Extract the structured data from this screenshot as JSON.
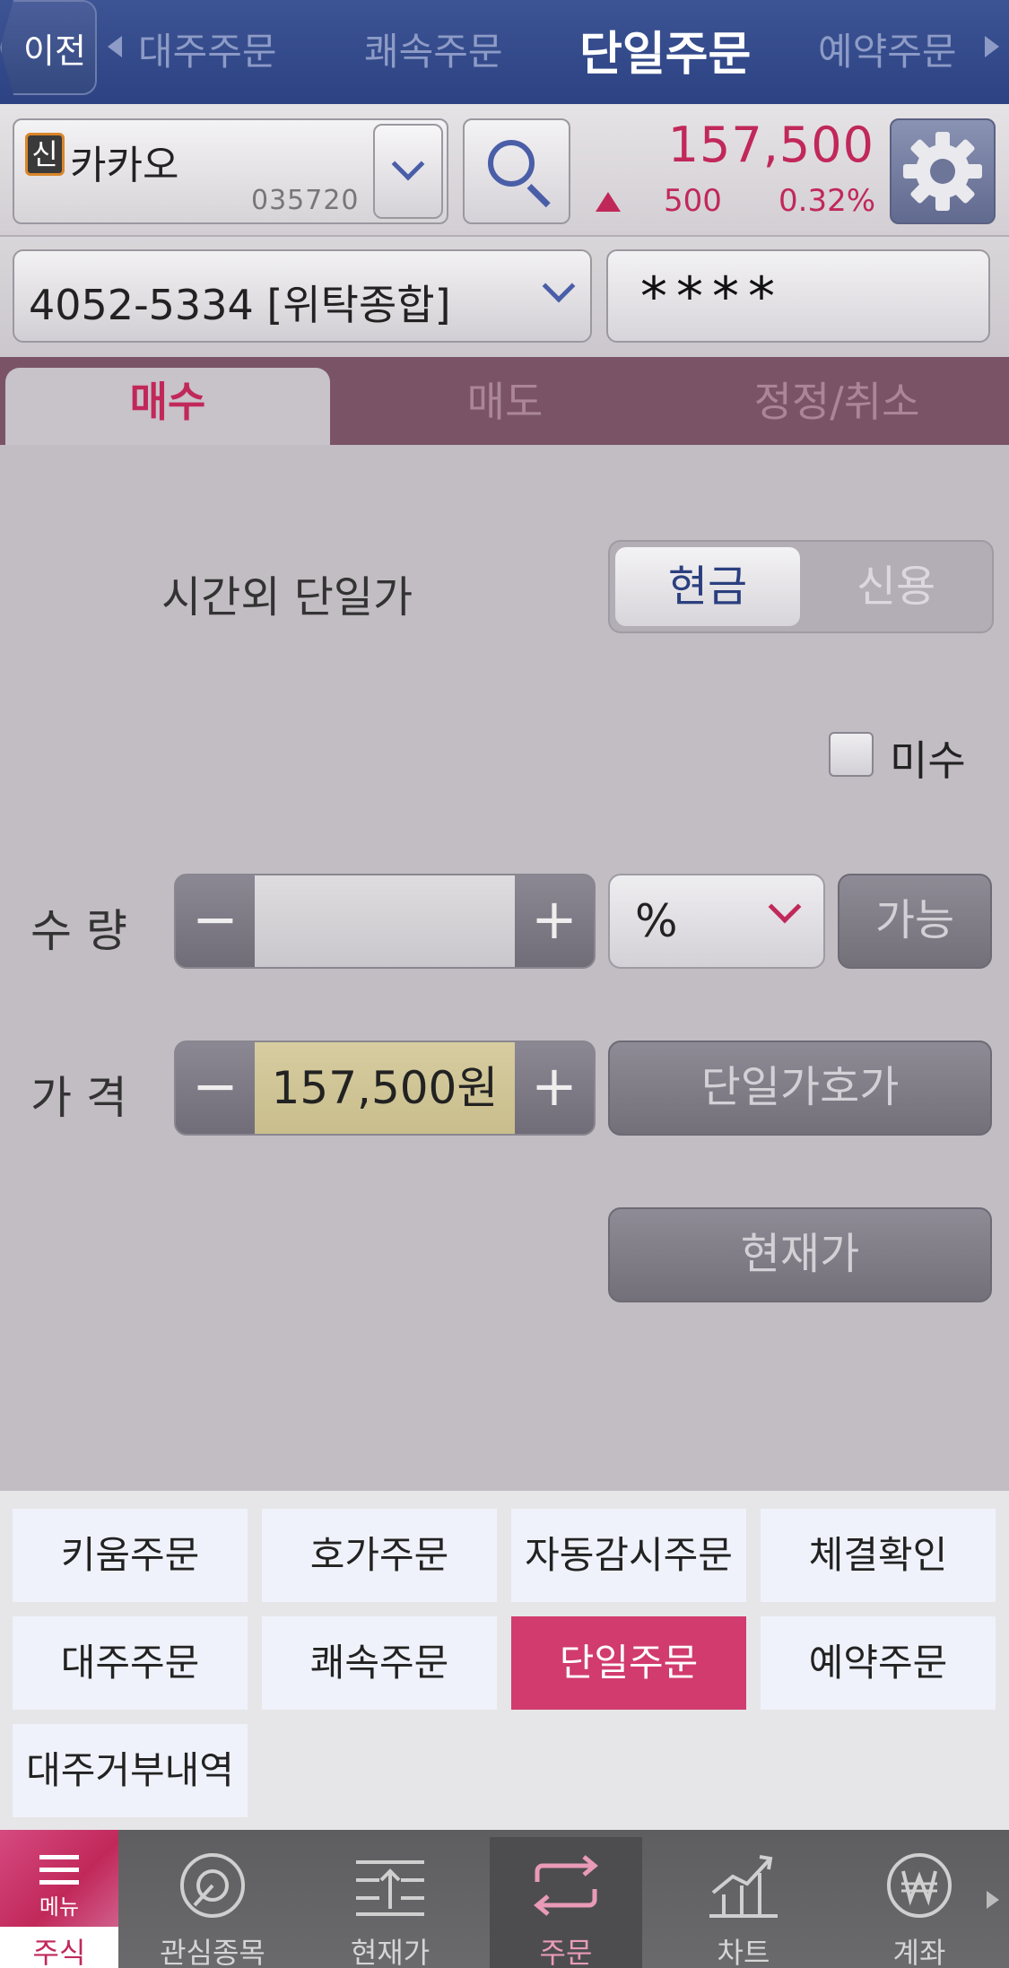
{
  "header": {
    "back_label": "이전",
    "tabs": [
      "대주주문",
      "쾌속주문",
      "단일주문",
      "예약주문"
    ],
    "active_tab": "단일주문"
  },
  "stock": {
    "badge": "신",
    "name": "카카오",
    "code": "035720",
    "price": "157,500",
    "change": "500",
    "change_rate": "0.32%",
    "up_color": "#c1285a"
  },
  "account": {
    "number": "4052-5334 [위탁종합]",
    "password": "****"
  },
  "order_tabs": [
    "매수",
    "매도",
    "정정/취소"
  ],
  "form": {
    "order_type": "시간외 단일가",
    "payment_options": [
      "현금",
      "신용"
    ],
    "selected_payment": "현금",
    "misu_label": "미수",
    "misu_checked": false,
    "quantity_label": "수 량",
    "quantity_value": "",
    "unit_select": "%",
    "available_button": "가능",
    "price_label": "가 격",
    "price_value": "157,500원",
    "single_price_button": "단일가호가",
    "current_price_button": "현재가",
    "minus": "−",
    "plus": "+"
  },
  "quick_menu": [
    "키움주문",
    "호가주문",
    "자동감시주문",
    "체결확인",
    "대주주문",
    "쾌속주문",
    "단일주문",
    "예약주문",
    "대주거부내역"
  ],
  "quick_menu_active": "단일주문",
  "bottom_nav": {
    "menu_small": "메뉴",
    "menu_label": "주식",
    "items": [
      {
        "label": "관심종목",
        "icon": "watchlist-icon"
      },
      {
        "label": "현재가",
        "icon": "current-price-icon"
      },
      {
        "label": "주문",
        "icon": "order-icon"
      },
      {
        "label": "차트",
        "icon": "chart-icon"
      },
      {
        "label": "계좌",
        "icon": "account-won-icon"
      }
    ],
    "active": "주문"
  },
  "colors": {
    "header": "#2c4283",
    "accent": "#c1285a",
    "tab_bar": "#7a5466",
    "quick_active": "#d13b6e"
  }
}
